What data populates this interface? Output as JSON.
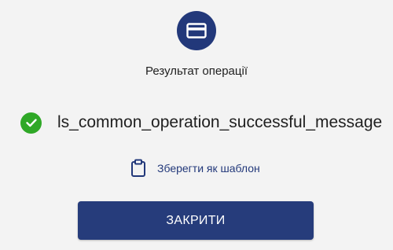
{
  "header": {
    "icon": "credit-card-icon",
    "accent_color": "#22387a"
  },
  "result": {
    "title": "Результат операції",
    "status_icon": "check-circle-icon",
    "status_color": "#2fa827",
    "message": "ls_common_operation_successful_message"
  },
  "actions": {
    "save_template_icon": "clipboard-icon",
    "save_template_label": "Зберегти як шаблон",
    "close_label": "ЗАКРИТИ"
  }
}
